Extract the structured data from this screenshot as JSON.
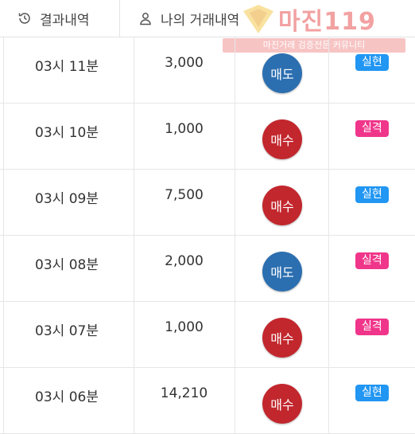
{
  "tabs": [
    {
      "label": "결과내역",
      "icon": "history-icon"
    },
    {
      "label": "나의 거래내역",
      "icon": "user-icon"
    }
  ],
  "watermark": {
    "title": "마진119",
    "subtitle": "마진거래 검증전문 커뮤니티"
  },
  "colors": {
    "sell": "#2c6fb0",
    "buy": "#c2272d",
    "success": "#2196f3",
    "fail": "#f0368a"
  },
  "rows": [
    {
      "time": "03시 11분",
      "amount": "3,000",
      "side": "매도",
      "side_type": "sell",
      "result": "실현",
      "result_type": "success"
    },
    {
      "time": "03시 10분",
      "amount": "1,000",
      "side": "매수",
      "side_type": "buy",
      "result": "실격",
      "result_type": "fail"
    },
    {
      "time": "03시 09분",
      "amount": "7,500",
      "side": "매수",
      "side_type": "buy",
      "result": "실현",
      "result_type": "success"
    },
    {
      "time": "03시 08분",
      "amount": "2,000",
      "side": "매도",
      "side_type": "sell",
      "result": "실격",
      "result_type": "fail"
    },
    {
      "time": "03시 07분",
      "amount": "1,000",
      "side": "매수",
      "side_type": "buy",
      "result": "실격",
      "result_type": "fail"
    },
    {
      "time": "03시 06분",
      "amount": "14,210",
      "side": "매수",
      "side_type": "buy",
      "result": "실현",
      "result_type": "success"
    }
  ]
}
